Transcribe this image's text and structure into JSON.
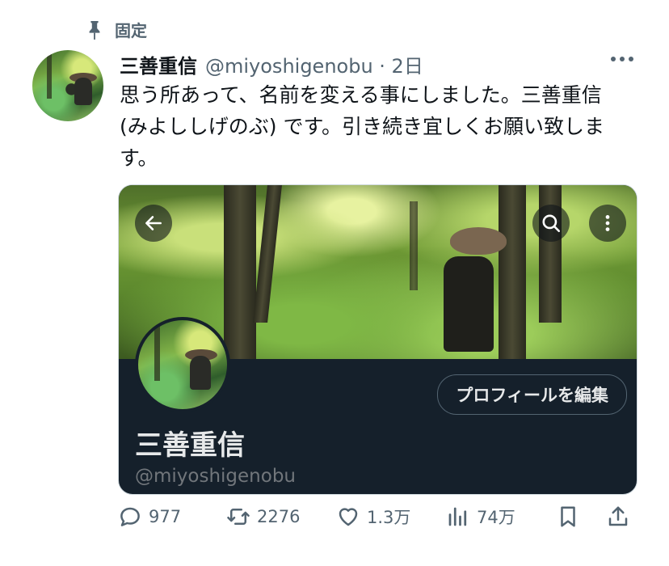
{
  "pinned": {
    "label": "固定",
    "icon": "pin-icon"
  },
  "tweet": {
    "display_name": "三善重信",
    "handle_time": "@miyoshigenobu · 2日",
    "text": "思う所あって、名前を変える事にしました。三善重信 (みよししげのぶ) です。引き続き宜しくお願い致します。"
  },
  "card": {
    "edit_button": "プロフィールを編集",
    "name": "三善重信",
    "handle": "@miyoshigenobu"
  },
  "actions": {
    "replies": "977",
    "retweets": "2276",
    "likes": "1.3万",
    "views": "74万"
  },
  "colors": {
    "card_bg": "#15202b",
    "muted": "#536471"
  }
}
